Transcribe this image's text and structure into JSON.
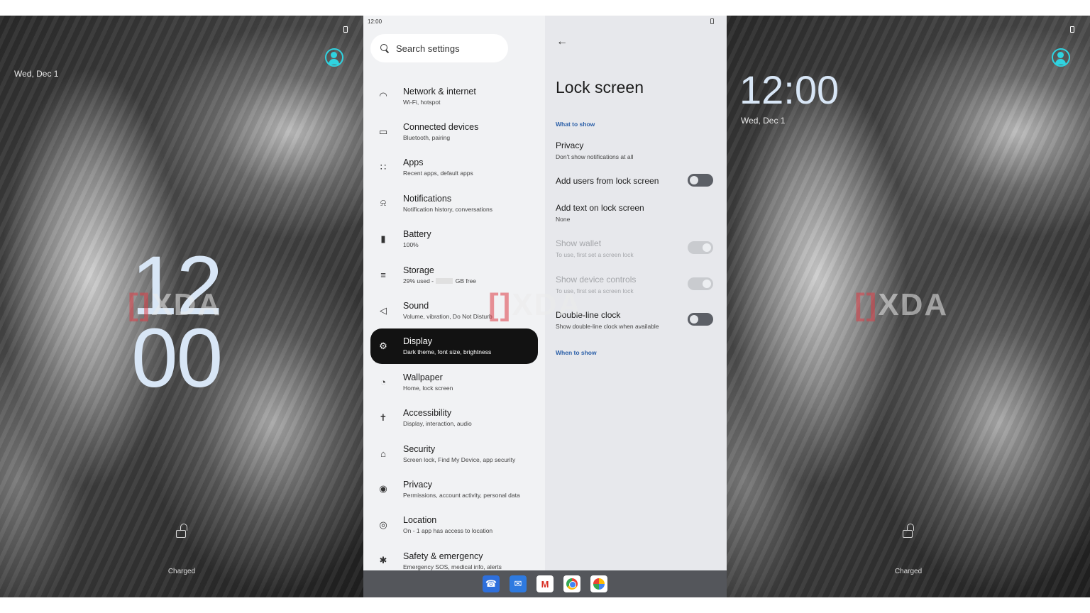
{
  "lock_left": {
    "date": "Wed, Dec 1",
    "clock_hours": "12",
    "clock_minutes": "00",
    "status": "Charged"
  },
  "lock_right": {
    "clock": "12:00",
    "date": "Wed, Dec 1",
    "status": "Charged"
  },
  "watermark": {
    "text": "XDA"
  },
  "statusbar": {
    "time": "12:00"
  },
  "search": {
    "placeholder": "Search settings"
  },
  "menu": [
    {
      "title": "Network & internet",
      "subtitle": "Wi-Fi, hotspot",
      "icon": "wifi-icon"
    },
    {
      "title": "Connected devices",
      "subtitle": "Bluetooth, pairing",
      "icon": "devices-icon"
    },
    {
      "title": "Apps",
      "subtitle": "Recent apps, default apps",
      "icon": "apps-grid-icon"
    },
    {
      "title": "Notifications",
      "subtitle": "Notification history, conversations",
      "icon": "bell-icon"
    },
    {
      "title": "Battery",
      "subtitle": "100%",
      "icon": "battery-icon"
    },
    {
      "title": "Storage",
      "subtitle_pre": "29% used -",
      "subtitle_post": "GB free",
      "icon": "storage-icon"
    },
    {
      "title": "Sound",
      "subtitle": "Volume, vibration, Do Not Disturb",
      "icon": "speaker-icon"
    },
    {
      "title": "Display",
      "subtitle": "Dark theme, font size, brightness",
      "icon": "brightness-icon",
      "active": true
    },
    {
      "title": "Wallpaper",
      "subtitle": "Home, lock screen",
      "icon": "palette-icon"
    },
    {
      "title": "Accessibility",
      "subtitle": "Display, interaction, audio",
      "icon": "accessibility-icon"
    },
    {
      "title": "Security",
      "subtitle": "Screen lock, Find My Device, app security",
      "icon": "lock-icon"
    },
    {
      "title": "Privacy",
      "subtitle": "Permissions, account activity, personal data",
      "icon": "eye-icon"
    },
    {
      "title": "Location",
      "subtitle": "On - 1 app has access to location",
      "icon": "location-pin-icon"
    },
    {
      "title": "Safety & emergency",
      "subtitle": "Emergency SOS, medical info, alerts",
      "icon": "asterisk-icon"
    }
  ],
  "detail": {
    "title": "Lock screen",
    "section_what": "What to show",
    "privacy_title": "Privacy",
    "privacy_sub": "Don't show notifications at all",
    "add_users_title": "Add users from lock screen",
    "add_text_title": "Add text on lock screen",
    "add_text_sub": "None",
    "wallet_title": "Show wallet",
    "wallet_sub": "To use, first set a screen lock",
    "device_controls_title": "Show device controls",
    "device_controls_sub": "To use, first set a screen lock",
    "double_clock_title": "Double-line clock",
    "double_clock_sub": "Show double-line clock when available",
    "section_when": "When to show"
  },
  "dock": {
    "apps": [
      "phone-app-icon",
      "messages-app-icon",
      "gmail-app-icon",
      "chrome-app-icon",
      "photos-app-icon"
    ],
    "gmail_glyph": "M"
  }
}
